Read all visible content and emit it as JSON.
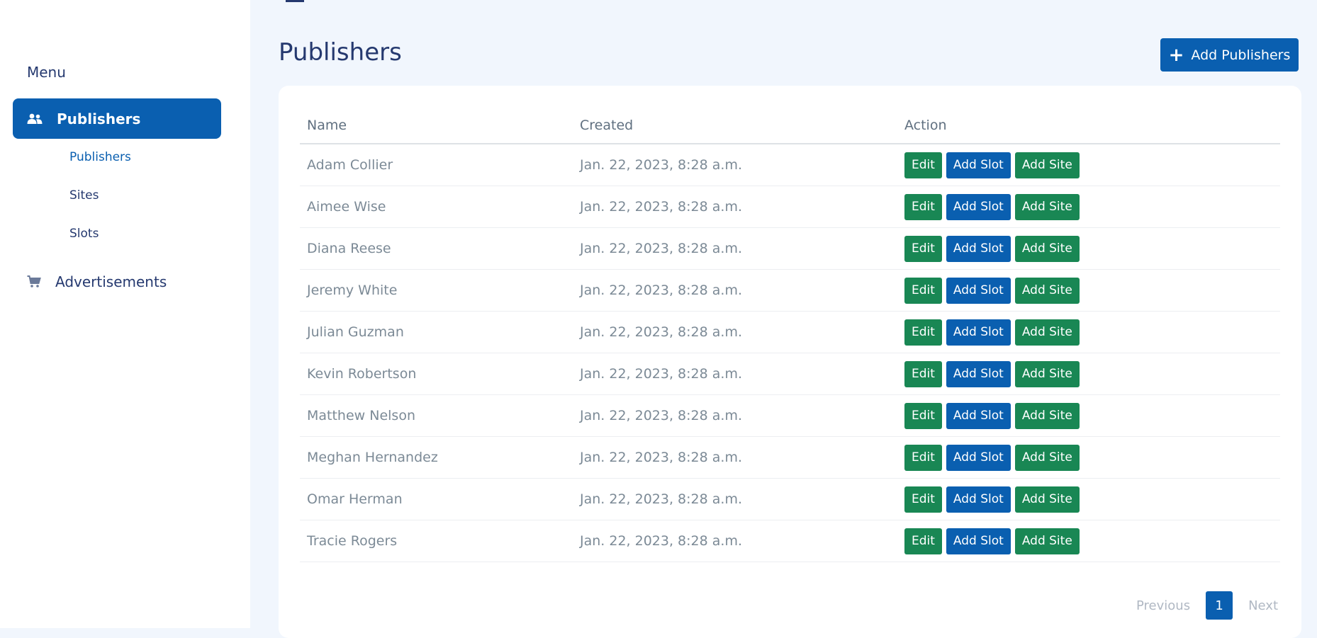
{
  "sidebar": {
    "menu_title": "Menu",
    "main_item": {
      "label": "Publishers",
      "icon": "users-icon"
    },
    "subitems": [
      {
        "label": "Publishers",
        "active": true
      },
      {
        "label": "Sites",
        "active": false
      },
      {
        "label": "Slots",
        "active": false
      }
    ],
    "ads_item": {
      "label": "Advertisements",
      "icon": "cart-icon"
    }
  },
  "header": {
    "title": "Publishers",
    "add_button_label": "Add Publishers"
  },
  "table": {
    "columns": [
      "Name",
      "Created",
      "Action"
    ],
    "action_labels": {
      "edit": "Edit",
      "add_slot": "Add Slot",
      "add_site": "Add Site"
    },
    "rows": [
      {
        "name": "Adam Collier",
        "created": "Jan. 22, 2023, 8:28 a.m."
      },
      {
        "name": "Aimee Wise",
        "created": "Jan. 22, 2023, 8:28 a.m."
      },
      {
        "name": "Diana Reese",
        "created": "Jan. 22, 2023, 8:28 a.m."
      },
      {
        "name": "Jeremy White",
        "created": "Jan. 22, 2023, 8:28 a.m."
      },
      {
        "name": "Julian Guzman",
        "created": "Jan. 22, 2023, 8:28 a.m."
      },
      {
        "name": "Kevin Robertson",
        "created": "Jan. 22, 2023, 8:28 a.m."
      },
      {
        "name": "Matthew Nelson",
        "created": "Jan. 22, 2023, 8:28 a.m."
      },
      {
        "name": "Meghan Hernandez",
        "created": "Jan. 22, 2023, 8:28 a.m."
      },
      {
        "name": "Omar Herman",
        "created": "Jan. 22, 2023, 8:28 a.m."
      },
      {
        "name": "Tracie Rogers",
        "created": "Jan. 22, 2023, 8:28 a.m."
      }
    ]
  },
  "pagination": {
    "previous": "Previous",
    "current": "1",
    "next": "Next"
  },
  "colors": {
    "primary": "#0a5fb0",
    "success": "#198754",
    "background": "#f1f6fd",
    "text": "#25396f"
  }
}
